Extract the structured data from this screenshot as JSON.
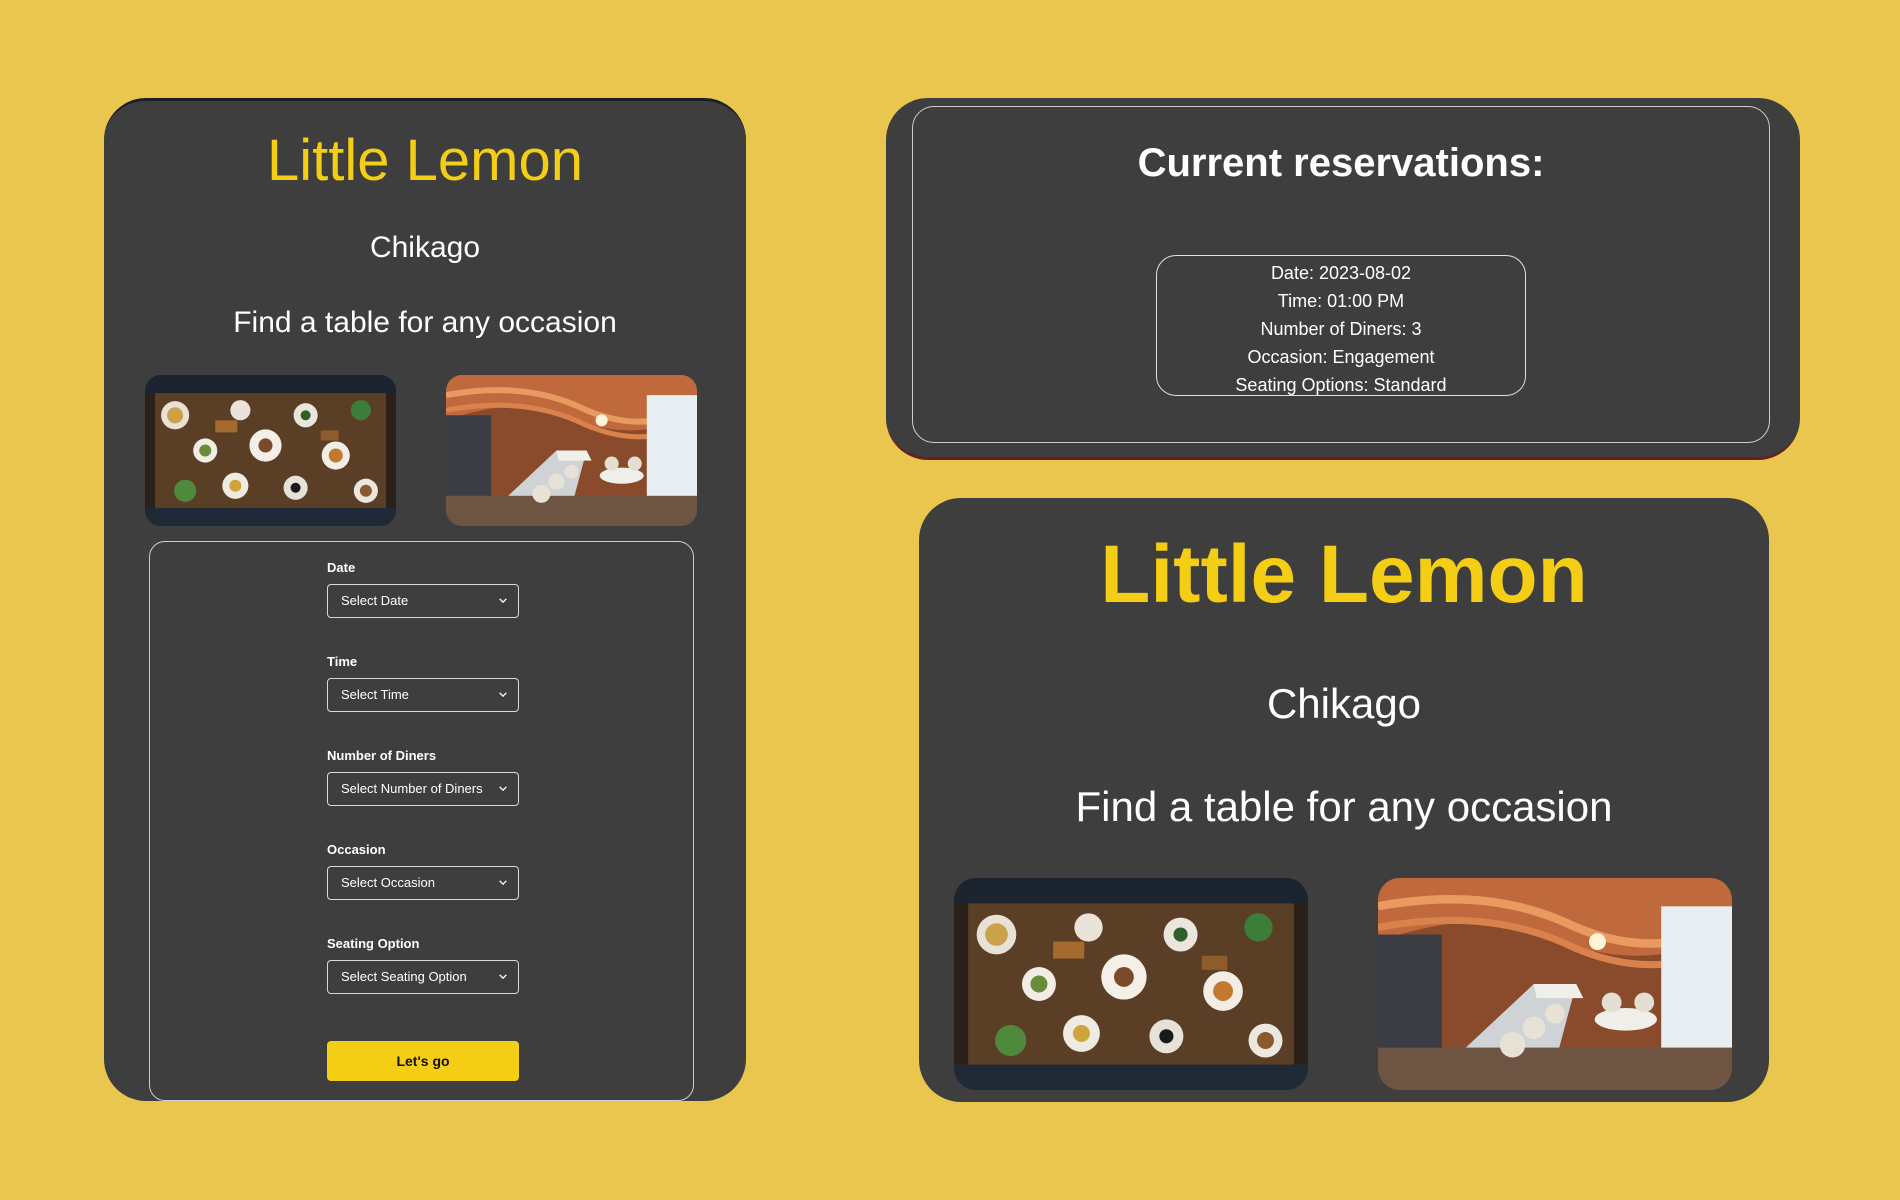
{
  "colors": {
    "background": "#E9C64D",
    "card": "#3E3E3E",
    "accent": "#F4CE14",
    "text": "#FFFFFF"
  },
  "mobile": {
    "brand": "Little Lemon",
    "city": "Chikago",
    "tagline": "Find a table for any occasion",
    "images": [
      "food-table-photo",
      "restaurant-interior-photo"
    ],
    "form": {
      "date": {
        "label": "Date",
        "value": "Select Date"
      },
      "time": {
        "label": "Time",
        "value": "Select Time"
      },
      "diners": {
        "label": "Number of Diners",
        "value": "Select Number of Diners"
      },
      "occasion": {
        "label": "Occasion",
        "value": "Select Occasion"
      },
      "seating": {
        "label": "Seating Option",
        "value": "Select Seating Option"
      },
      "submit_label": "Let's go"
    }
  },
  "reservations": {
    "title": "Current reservations:",
    "items": [
      {
        "date": "Date: 2023-08-02",
        "time": "Time: 01:00 PM",
        "diners": "Number of Diners: 3",
        "occasion": "Occasion: Engagement",
        "seating": "Seating Options: Standard"
      }
    ]
  },
  "desktop": {
    "brand": "Little Lemon",
    "city": "Chikago",
    "tagline": "Find a table for any occasion",
    "images": [
      "food-table-photo",
      "restaurant-interior-photo"
    ]
  }
}
